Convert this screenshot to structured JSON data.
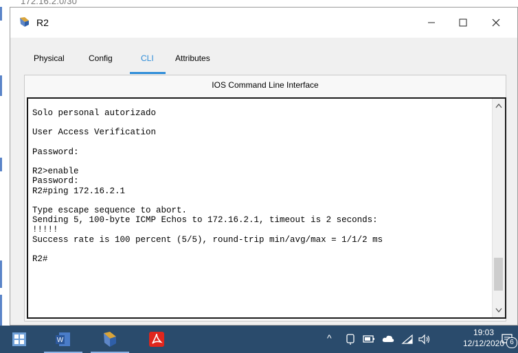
{
  "background": {
    "top_text": "172.16.2.0/30"
  },
  "window": {
    "title": "R2",
    "minimize_label": "—",
    "close_label": "✕"
  },
  "tabs": [
    {
      "label": "Physical"
    },
    {
      "label": "Config"
    },
    {
      "label": "CLI",
      "active": true
    },
    {
      "label": "Attributes"
    }
  ],
  "panel": {
    "title": "IOS Command Line Interface",
    "terminal_text": "Solo personal autorizado\n\nUser Access Verification\n\nPassword:\n\nR2>enable\nPassword:\nR2#ping 172.16.2.1\n\nType escape sequence to abort.\nSending 5, 100-byte ICMP Echos to 172.16.2.1, timeout is 2 seconds:\n!!!!!\nSuccess rate is 100 percent (5/5), round-trip min/avg/max = 1/1/2 ms\n\nR2#"
  },
  "taskbar": {
    "icons": [
      "windows-start-icon",
      "word-icon",
      "packet-tracer-icon",
      "acrobat-icon"
    ],
    "tray_chevron": "^",
    "time": "19:03",
    "date": "12/12/2020",
    "notification_count": "6"
  },
  "colors": {
    "accent": "#2a8bd8",
    "taskbar": "#2a4b6c"
  }
}
